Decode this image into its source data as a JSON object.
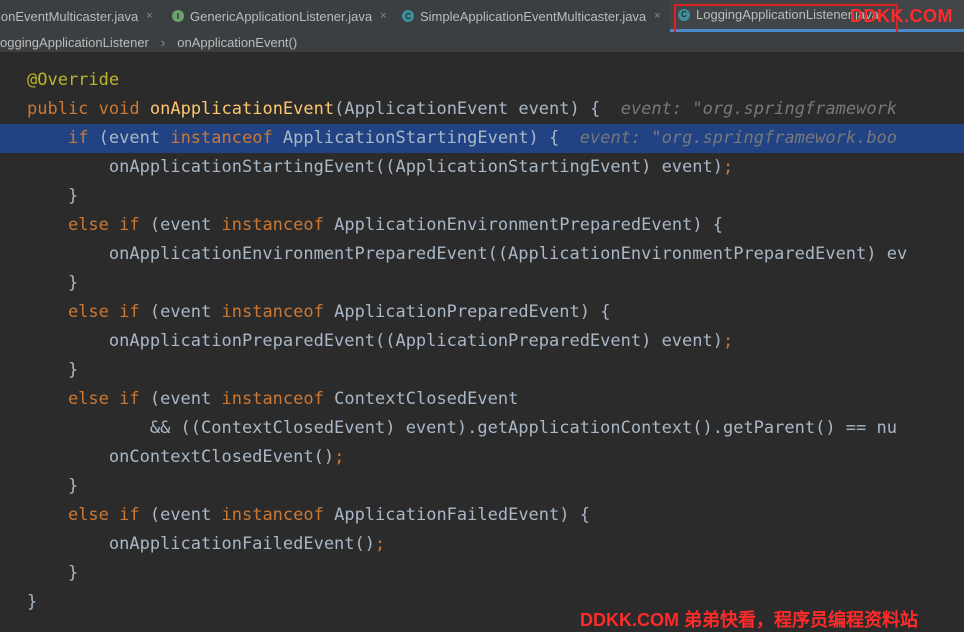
{
  "tabs": [
    {
      "label": "ionEventMulticaster.java",
      "icon": "",
      "active": false
    },
    {
      "label": "GenericApplicationListener.java",
      "icon": "I",
      "active": false
    },
    {
      "label": "SimpleApplicationEventMulticaster.java",
      "icon": "C",
      "active": false
    },
    {
      "label": "LoggingApplicationListener.java",
      "icon": "C",
      "active": true
    }
  ],
  "close_glyph": "×",
  "watermark_top": "DDKK.COM",
  "breadcrumb": [
    "oggingApplicationListener",
    "onApplicationEvent()"
  ],
  "breadcrumb_sep": "›",
  "code": {
    "l1": {
      "ann": "@Override"
    },
    "l2": {
      "kw1": "public",
      "kw2": "void",
      "fn": "onApplicationEvent",
      "rest": "(ApplicationEvent event) {",
      "hint": "event: \"org.springframework"
    },
    "l3": {
      "kw1": "if",
      "t1": " (event ",
      "kw2": "instanceof",
      "t2": " ApplicationStartingEvent) {",
      "hint": "event: \"org.springframework.boo"
    },
    "l4": {
      "t": "onApplicationStartingEvent((ApplicationStartingEvent) event)",
      "semi": ";"
    },
    "l5": {
      "t": "}"
    },
    "l6": {
      "kw1": "else if",
      "t1": " (event ",
      "kw2": "instanceof",
      "t2": " ApplicationEnvironmentPreparedEvent) {"
    },
    "l7": {
      "t": "onApplicationEnvironmentPreparedEvent((ApplicationEnvironmentPreparedEvent) ev"
    },
    "l8": {
      "t": "}"
    },
    "l9": {
      "kw1": "else if",
      "t1": " (event ",
      "kw2": "instanceof",
      "t2": " ApplicationPreparedEvent) {"
    },
    "l10": {
      "t": "onApplicationPreparedEvent((ApplicationPreparedEvent) event)",
      "semi": ";"
    },
    "l11": {
      "t": "}"
    },
    "l12": {
      "kw1": "else if",
      "t1": " (event ",
      "kw2": "instanceof",
      "t2": " ContextClosedEvent"
    },
    "l13": {
      "t": "&& ((ContextClosedEvent) event).getApplicationContext().getParent() == nu"
    },
    "l14": {
      "t": "onContextClosedEvent()",
      "semi": ";"
    },
    "l15": {
      "t": "}"
    },
    "l16": {
      "kw1": "else if",
      "t1": " (event ",
      "kw2": "instanceof",
      "t2": " ApplicationFailedEvent) {"
    },
    "l17": {
      "t": "onApplicationFailedEvent()",
      "semi": ";"
    },
    "l18": {
      "t": "}"
    },
    "l19": {
      "t": "}"
    }
  },
  "watermark_bottom": "DDKK.COM 弟弟快看，程序员编程资料站",
  "colors": {
    "accent": "#4a88c7",
    "keyword": "#cc7832",
    "annotation": "#bbb529",
    "method": "#ffc66d",
    "text": "#a9b7c6",
    "watermark": "#ff2a2a"
  }
}
